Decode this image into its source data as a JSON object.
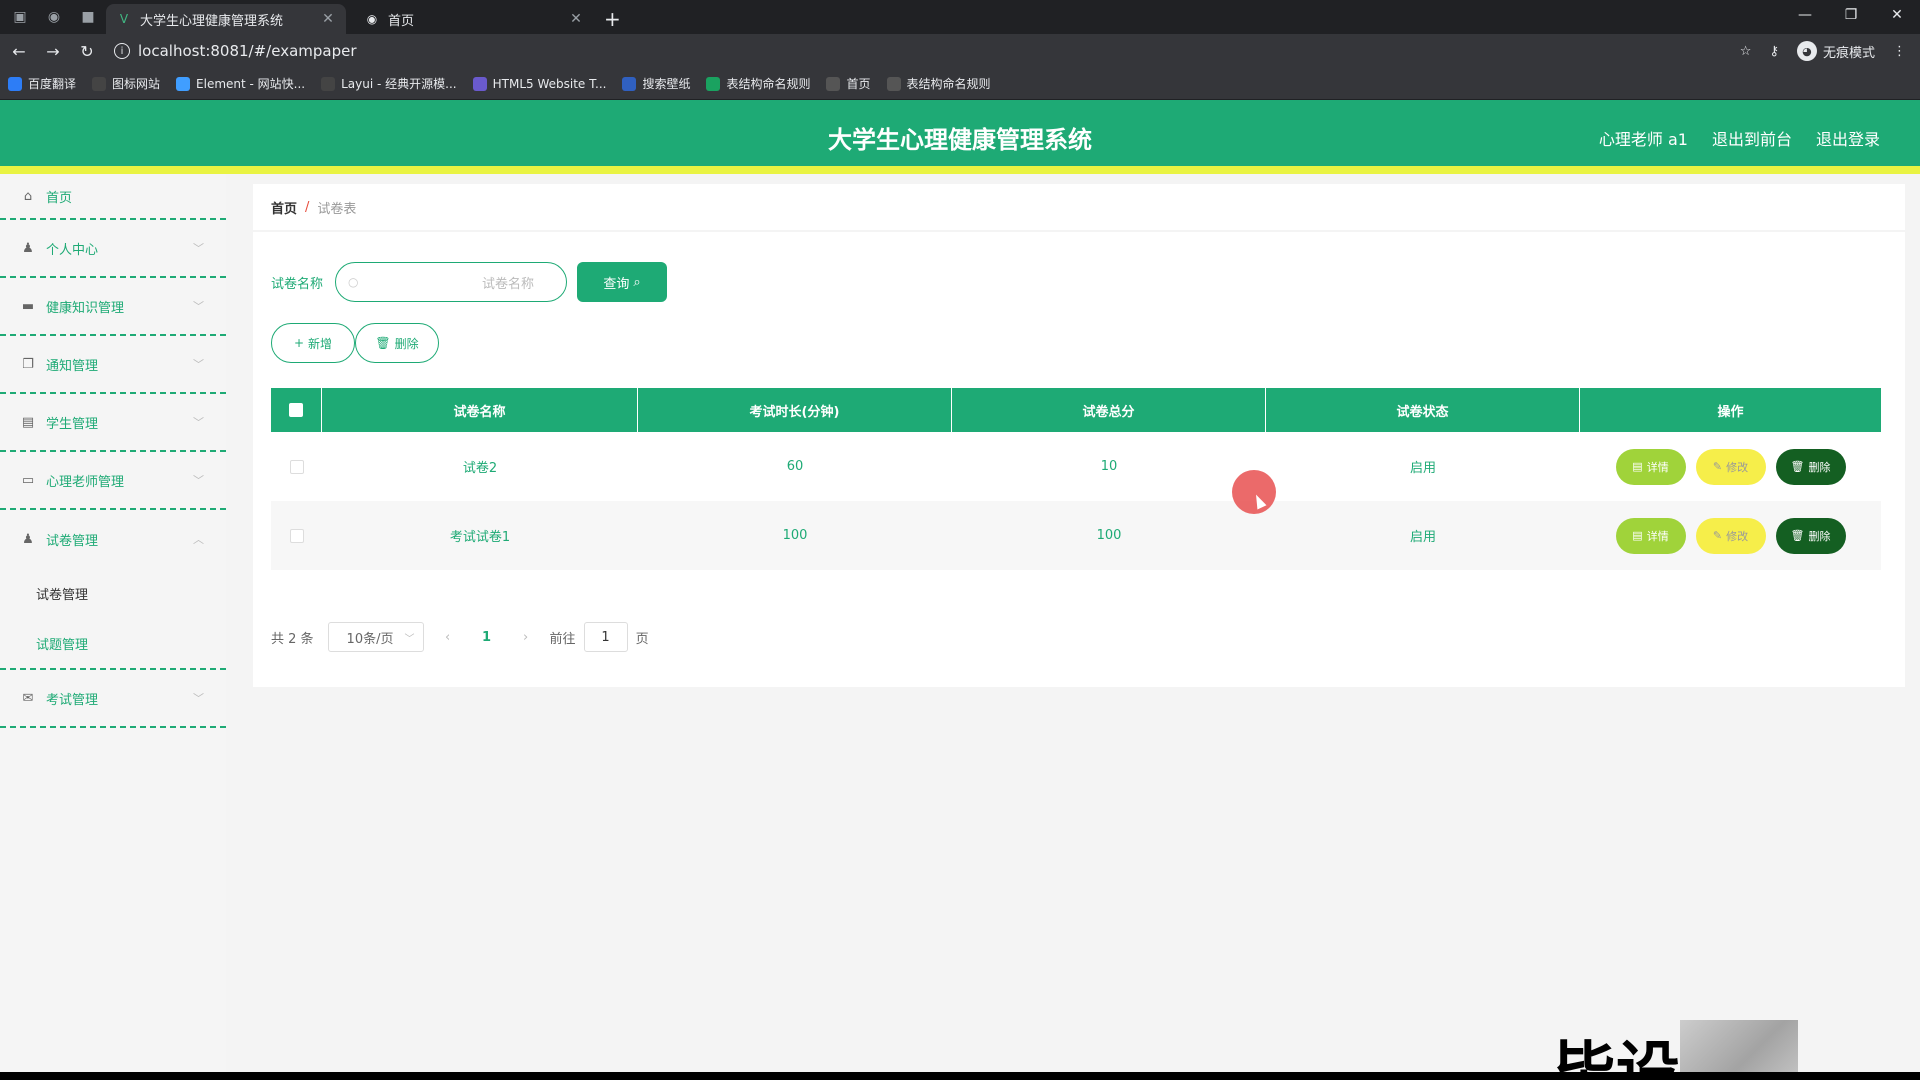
{
  "browser": {
    "tabs": [
      {
        "label": "大学生心理健康管理系统",
        "active": true
      },
      {
        "label": "首页",
        "active": false
      }
    ],
    "url": "localhost:8081/#/exampaper",
    "incognito_label": "无痕模式",
    "bookmarks": [
      {
        "label": "百度翻译",
        "color": "#2d7df6"
      },
      {
        "label": "图标网站",
        "color": "#444444"
      },
      {
        "label": "Element - 网站快...",
        "color": "#409eff"
      },
      {
        "label": "Layui - 经典开源模...",
        "color": "#444444"
      },
      {
        "label": "HTML5 Website T...",
        "color": "#6a5acd"
      },
      {
        "label": "搜索壁纸",
        "color": "#3060c0"
      },
      {
        "label": "表结构命名规则",
        "color": "#1aa260"
      },
      {
        "label": "首页",
        "color": "#555555"
      },
      {
        "label": "表结构命名规则",
        "color": "#555555"
      }
    ]
  },
  "header": {
    "title": "大学生心理健康管理系统",
    "user": "心理老师 a1",
    "front_link": "退出到前台",
    "logout_link": "退出登录"
  },
  "sidebar": {
    "home": "首页",
    "items": [
      {
        "label": "个人中心",
        "icon": "user-icon"
      },
      {
        "label": "健康知识管理",
        "icon": "monitor-icon"
      },
      {
        "label": "通知管理",
        "icon": "copy-icon"
      },
      {
        "label": "学生管理",
        "icon": "clipboard-icon"
      },
      {
        "label": "心理老师管理",
        "icon": "chat-icon"
      },
      {
        "label": "试卷管理",
        "icon": "user-icon"
      }
    ],
    "sub_items": [
      "试卷管理",
      "试题管理"
    ],
    "last_item": "考试管理"
  },
  "breadcrumb": {
    "home": "首页",
    "sep": "/",
    "current": "试卷表"
  },
  "search": {
    "label": "试卷名称",
    "placeholder": "试卷名称",
    "button": "查询"
  },
  "actions": {
    "add": "新增",
    "delete": "删除"
  },
  "table": {
    "headers": [
      "试卷名称",
      "考试时长(分钟)",
      "试卷总分",
      "试卷状态",
      "操作"
    ],
    "rows": [
      {
        "name": "试卷2",
        "duration": "60",
        "score": "10",
        "status": "启用"
      },
      {
        "name": "考试试卷1",
        "duration": "100",
        "score": "100",
        "status": "启用"
      }
    ],
    "op_labels": {
      "detail": "详情",
      "edit": "修改",
      "delete": "删除"
    }
  },
  "pager": {
    "total": "共 2 条",
    "size": "10条/页",
    "current": "1",
    "goto_prefix": "前往",
    "goto_value": "1",
    "goto_suffix": "页"
  },
  "watermark": "毕设",
  "colors": {
    "primary": "#1eaa75",
    "accent_strip": "#e9f342",
    "detail": "#a0d33a",
    "edit": "#f6ee4a",
    "delete": "#145f22"
  }
}
